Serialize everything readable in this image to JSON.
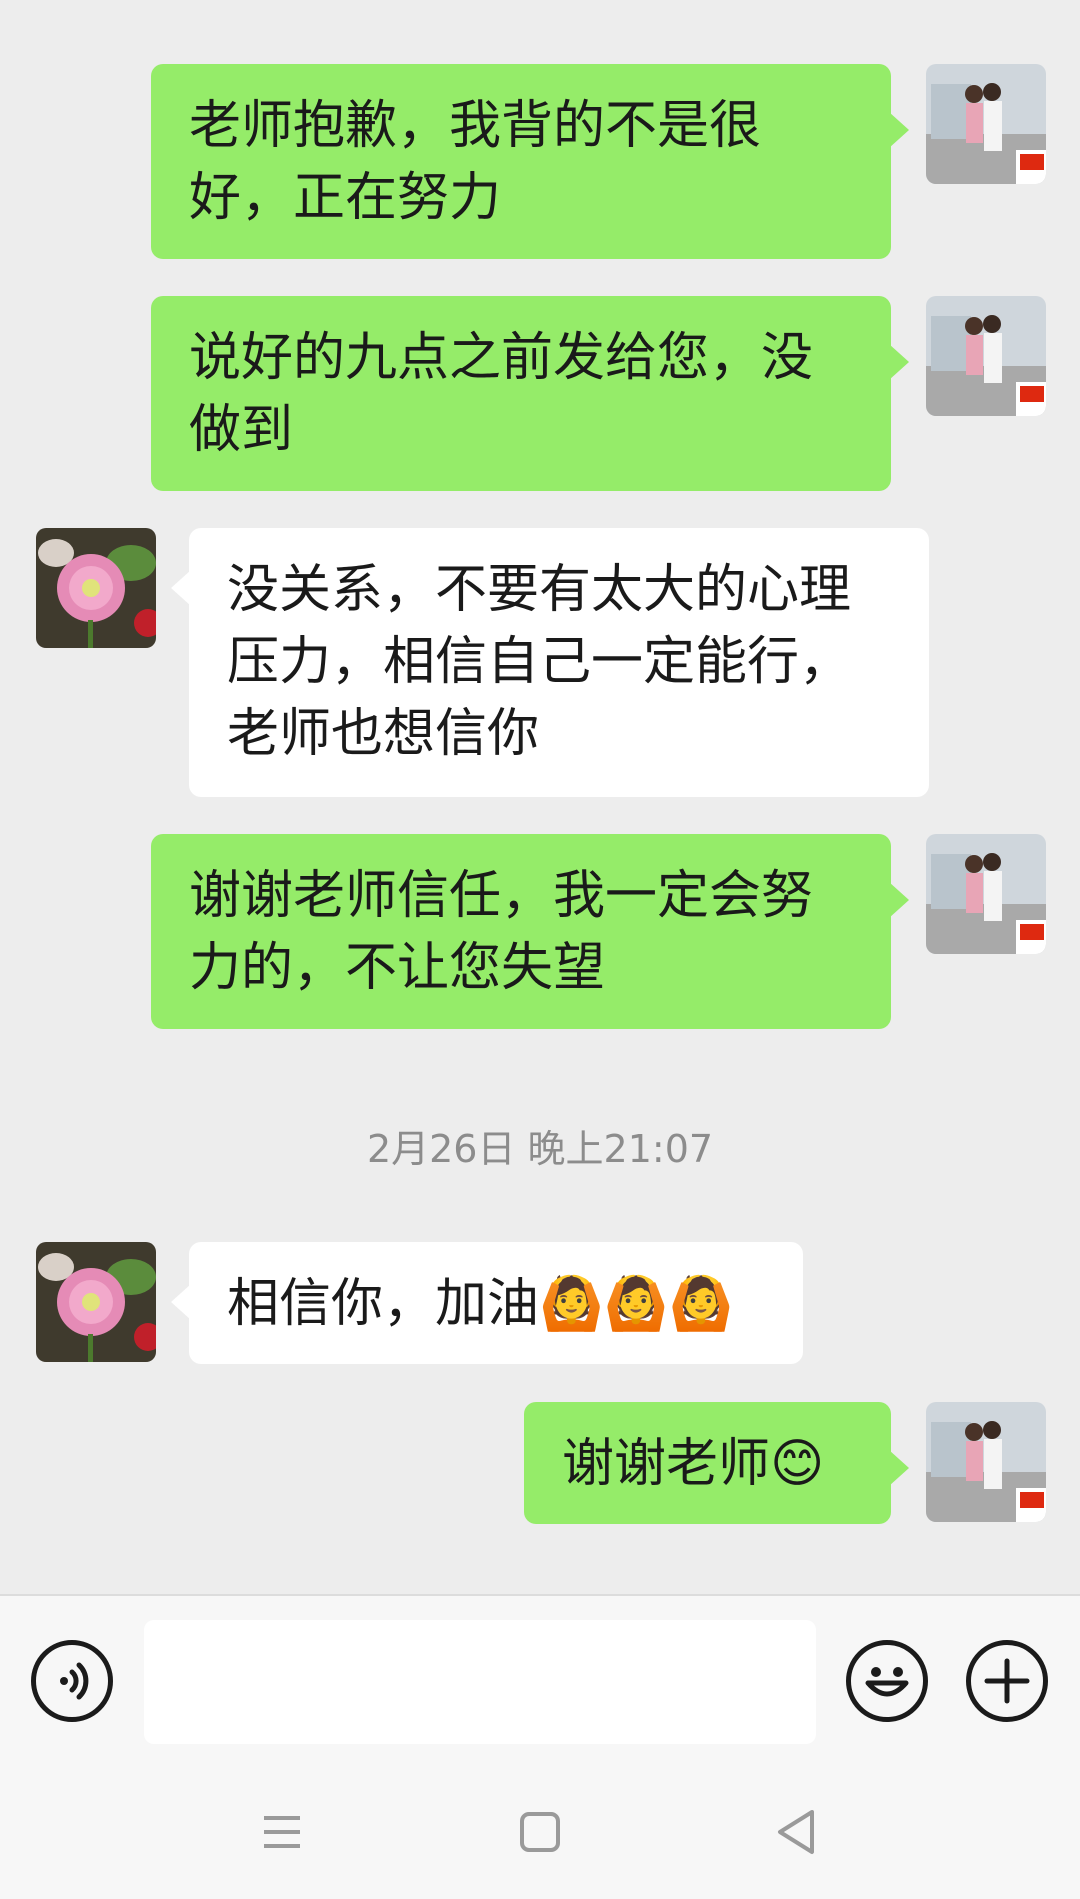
{
  "messages": [
    {
      "side": "sent",
      "text": "老师抱歉，我背的不是很好，正在努力"
    },
    {
      "side": "sent",
      "text": "说好的九点之前发给您，没做到"
    },
    {
      "side": "recv",
      "text": "没关系，不要有太大的心理压力，相信自己一定能行，老师也想信你"
    },
    {
      "side": "sent",
      "text": "谢谢老师信任，我一定会努力的，不让您失望"
    },
    {
      "side": "recv",
      "text": "相信你，加油🙆🙆🙆"
    },
    {
      "side": "sent",
      "text": "谢谢老师😊"
    }
  ],
  "timestamp": "2月26日 晚上21:07",
  "input_bar": {
    "voice_icon": "voice-icon",
    "emoji_icon": "smiley-icon",
    "more_icon": "plus-icon",
    "text_value": ""
  },
  "navbar": {
    "icons": [
      "menu-icon",
      "home-square-icon",
      "back-triangle-icon"
    ]
  },
  "colors": {
    "sent_bubble": "#95ec69",
    "recv_bubble": "#ffffff",
    "background": "#ededed"
  }
}
